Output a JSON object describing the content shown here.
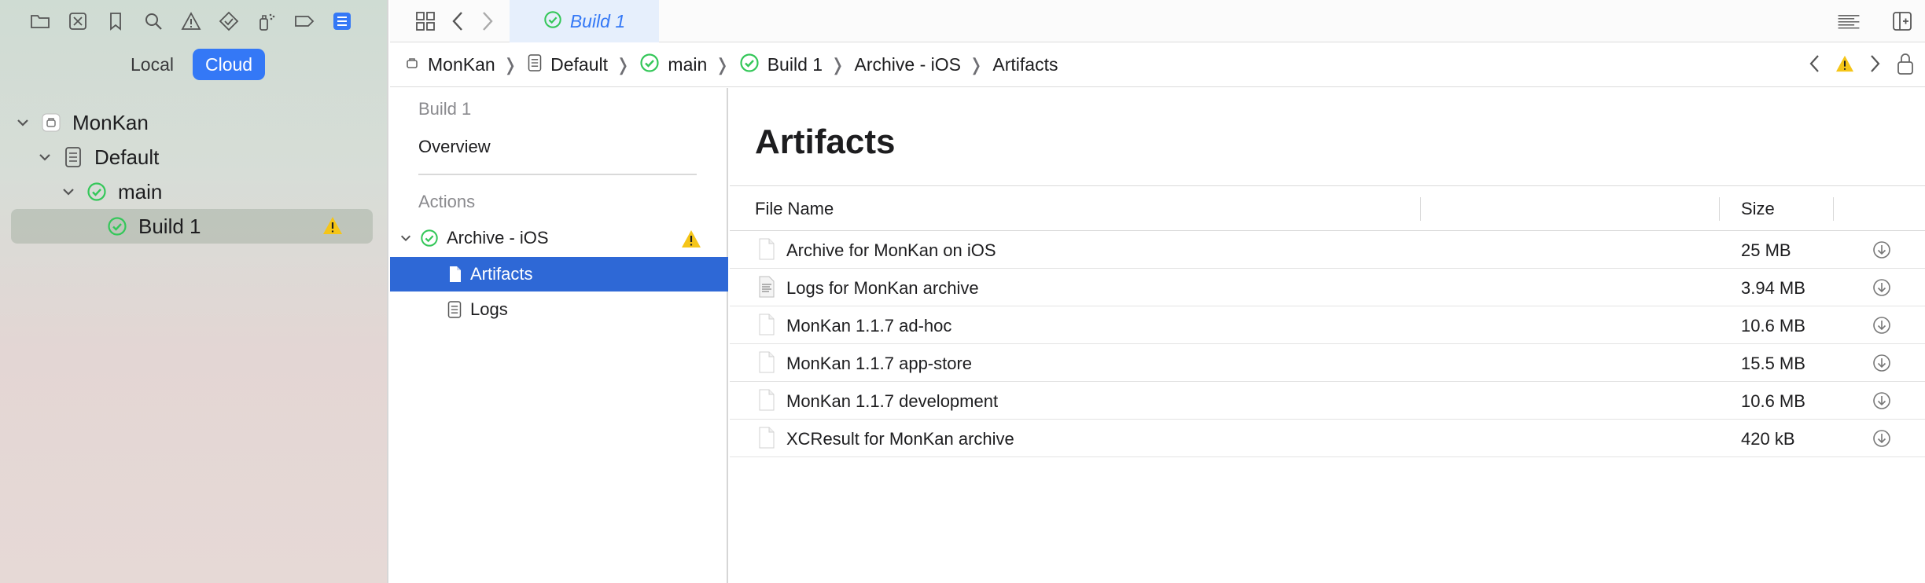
{
  "navigator": {
    "toolbar_icons": [
      "folder-icon",
      "source-control-icon",
      "bookmark-icon",
      "search-icon",
      "issue-warning-icon",
      "test-diamond-icon",
      "debug-spray-icon",
      "breakpoint-icon",
      "report-navigator-icon"
    ],
    "segments": [
      "Local",
      "Cloud"
    ],
    "selected_segment": "Cloud",
    "tree": [
      {
        "label": "MonKan",
        "icon": "product-icon",
        "level": 0
      },
      {
        "label": "Default",
        "icon": "document-icon",
        "level": 1
      },
      {
        "label": "main",
        "icon": "check-circle-icon",
        "level": 2
      },
      {
        "label": "Build 1",
        "icon": "check-circle-icon",
        "level": 3,
        "warning": true,
        "selected": true
      }
    ]
  },
  "tab": {
    "label": "Build 1"
  },
  "breadcrumb": [
    "MonKan",
    "Default",
    "main",
    "Build 1",
    "Archive - iOS",
    "Artifacts"
  ],
  "outline": {
    "build_heading": "Build 1",
    "overview": "Overview",
    "actions_heading": "Actions",
    "action": "Archive - iOS",
    "children": [
      "Artifacts",
      "Logs"
    ],
    "selected": "Artifacts"
  },
  "content": {
    "title": "Artifacts",
    "columns": {
      "name": "File Name",
      "size": "Size"
    },
    "rows": [
      {
        "name": "Archive for MonKan on iOS",
        "size": "25 MB"
      },
      {
        "name": "Logs for MonKan archive",
        "size": "3.94 MB"
      },
      {
        "name": "MonKan 1.1.7 ad-hoc",
        "size": "10.6 MB"
      },
      {
        "name": "MonKan 1.1.7 app-store",
        "size": "15.5 MB"
      },
      {
        "name": "MonKan 1.1.7 development",
        "size": "10.6 MB"
      },
      {
        "name": "XCResult for MonKan archive",
        "size": "420 kB"
      }
    ]
  },
  "colors": {
    "accent": "#3478f6",
    "selection": "#2e68d6",
    "success": "#34c759",
    "warning": "#f5c518"
  }
}
